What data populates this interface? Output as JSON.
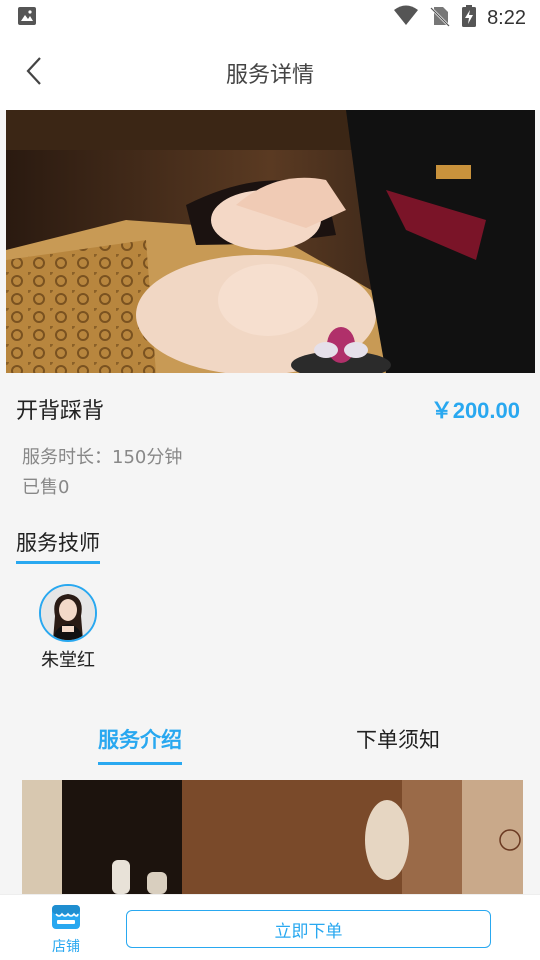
{
  "status_bar": {
    "time": "8:22"
  },
  "header": {
    "title": "服务详情"
  },
  "service": {
    "name": "开背踩背",
    "price": "￥200.00",
    "duration": "服务时长：150分钟",
    "sold": "已售0"
  },
  "technicians": {
    "section_title": "服务技师",
    "items": [
      {
        "name": "朱堂红"
      }
    ]
  },
  "tabs": [
    {
      "label": "服务介绍",
      "active": true
    },
    {
      "label": "下单须知",
      "active": false
    }
  ],
  "bottom_bar": {
    "shop_label": "店铺",
    "order_label": "立即下单"
  },
  "colors": {
    "accent": "#29a8f0"
  }
}
